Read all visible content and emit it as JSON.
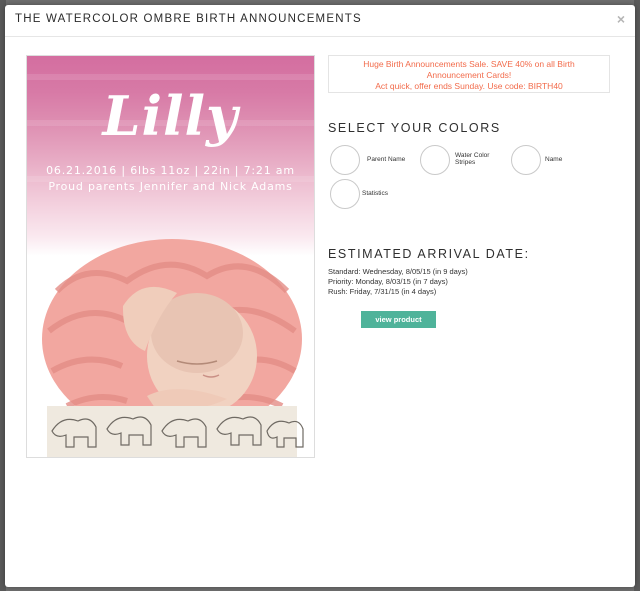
{
  "modal": {
    "title": "THE WATERCOLOR OMBRE BIRTH ANNOUNCEMENTS",
    "close_glyph": "×"
  },
  "card": {
    "name": "Lilly",
    "details_line": "06.21.2016 | 6lbs 11oz | 22in | 7:21 am",
    "parents_line": "Proud parents Jennifer and Nick Adams",
    "wash_color": "#d46ea0",
    "blanket_color": "#f2a7a0"
  },
  "sale": {
    "line1": "Huge Birth Announcements Sale. SAVE 40% on all Birth",
    "line2": "Announcement Cards!",
    "line3": "Act quick, offer ends Sunday. Use code: BIRTH40",
    "color": "#f26b4b"
  },
  "colors_section": {
    "heading": "SELECT YOUR COLORS",
    "swatches": [
      {
        "label": "Parent Name"
      },
      {
        "label_line1": "Water Color",
        "label_line2": "Stripes"
      },
      {
        "label": "Name"
      },
      {
        "label": "Statistics"
      }
    ]
  },
  "arrival": {
    "heading": "ESTIMATED ARRIVAL DATE:",
    "standard": "Standard: Wednesday, 8/05/15 (in 9 days)",
    "priority": "Priority: Monday, 8/03/15 (in 7 days)",
    "rush": "Rush: Friday, 7/31/15 (in 4 days)"
  },
  "actions": {
    "view_product": "view product",
    "button_color": "#4fb39a"
  }
}
